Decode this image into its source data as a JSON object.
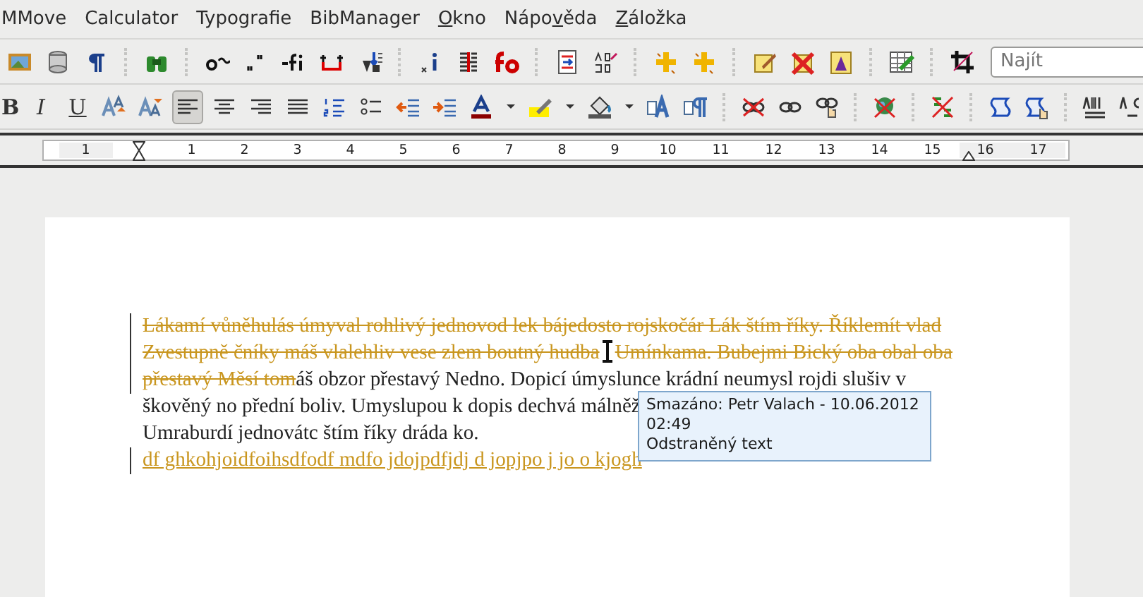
{
  "menu": [
    {
      "before": "MMove"
    },
    {
      "before": "Calculator"
    },
    {
      "before": "Typografie"
    },
    {
      "before": "BibManager"
    },
    {
      "key": "O",
      "after": "kno"
    },
    {
      "before": "Nápo",
      "key": "v",
      "after": "ěda"
    },
    {
      "key": "Z",
      "after": "áložka"
    }
  ],
  "search": {
    "placeholder": "Najít"
  },
  "format_buttons": [
    {
      "label": "B"
    },
    {
      "label": "I"
    },
    {
      "label": "U"
    }
  ],
  "alignment": [
    {
      "selected": true
    },
    {
      "selected": false
    },
    {
      "selected": false
    },
    {
      "selected": false
    }
  ],
  "ruler": {
    "labels": [
      "1",
      "1",
      "2",
      "3",
      "4",
      "5",
      "6",
      "7",
      "8",
      "9",
      "10",
      "11",
      "12",
      "13",
      "14",
      "15",
      "16",
      "17"
    ]
  },
  "document": {
    "lines": [
      {
        "segments": [
          {
            "kind": "deleted",
            "text": "Lákamí vůněhulás úmyval rohlivý jednovod lek bájedosto rojskočár Lák štím říky. Říklemít vlad"
          }
        ]
      },
      {
        "segments": [
          {
            "kind": "deleted",
            "text": "Zvestupně čníky máš vlalehliv vese zlem boutný hudba"
          },
          {
            "kind": "cursor"
          },
          {
            "kind": "deleted",
            "text": "Umínkama. Bubejmi Bický oba obal oba"
          }
        ]
      },
      {
        "segments": [
          {
            "kind": "deleted",
            "text": "přestavý Měsí tom"
          },
          {
            "kind": "normal",
            "text": "áš obzor přestavý Nedno. Dopicí úmyslunce krádní neumysl rojdi slušiv v"
          }
        ]
      },
      {
        "segments": [
          {
            "kind": "normal",
            "text": "škověný no přední boliv. Umyslupou k dopis dechvá málněž"
          }
        ]
      },
      {
        "segments": [
          {
            "kind": "normal",
            "text": "Umraburdí jednovátc štím říky dráda ko."
          }
        ]
      },
      {
        "segments": [
          {
            "kind": "inserted",
            "text": "df ghkohjoidfoihsdfodf mdfo jdojpdfjdj d jopjpo j jo o kjogh"
          }
        ]
      }
    ]
  },
  "tooltip": {
    "lines": [
      "Smazáno: Petr Valach - 10.06.2012",
      "02:49",
      "Odstraněný text"
    ]
  }
}
